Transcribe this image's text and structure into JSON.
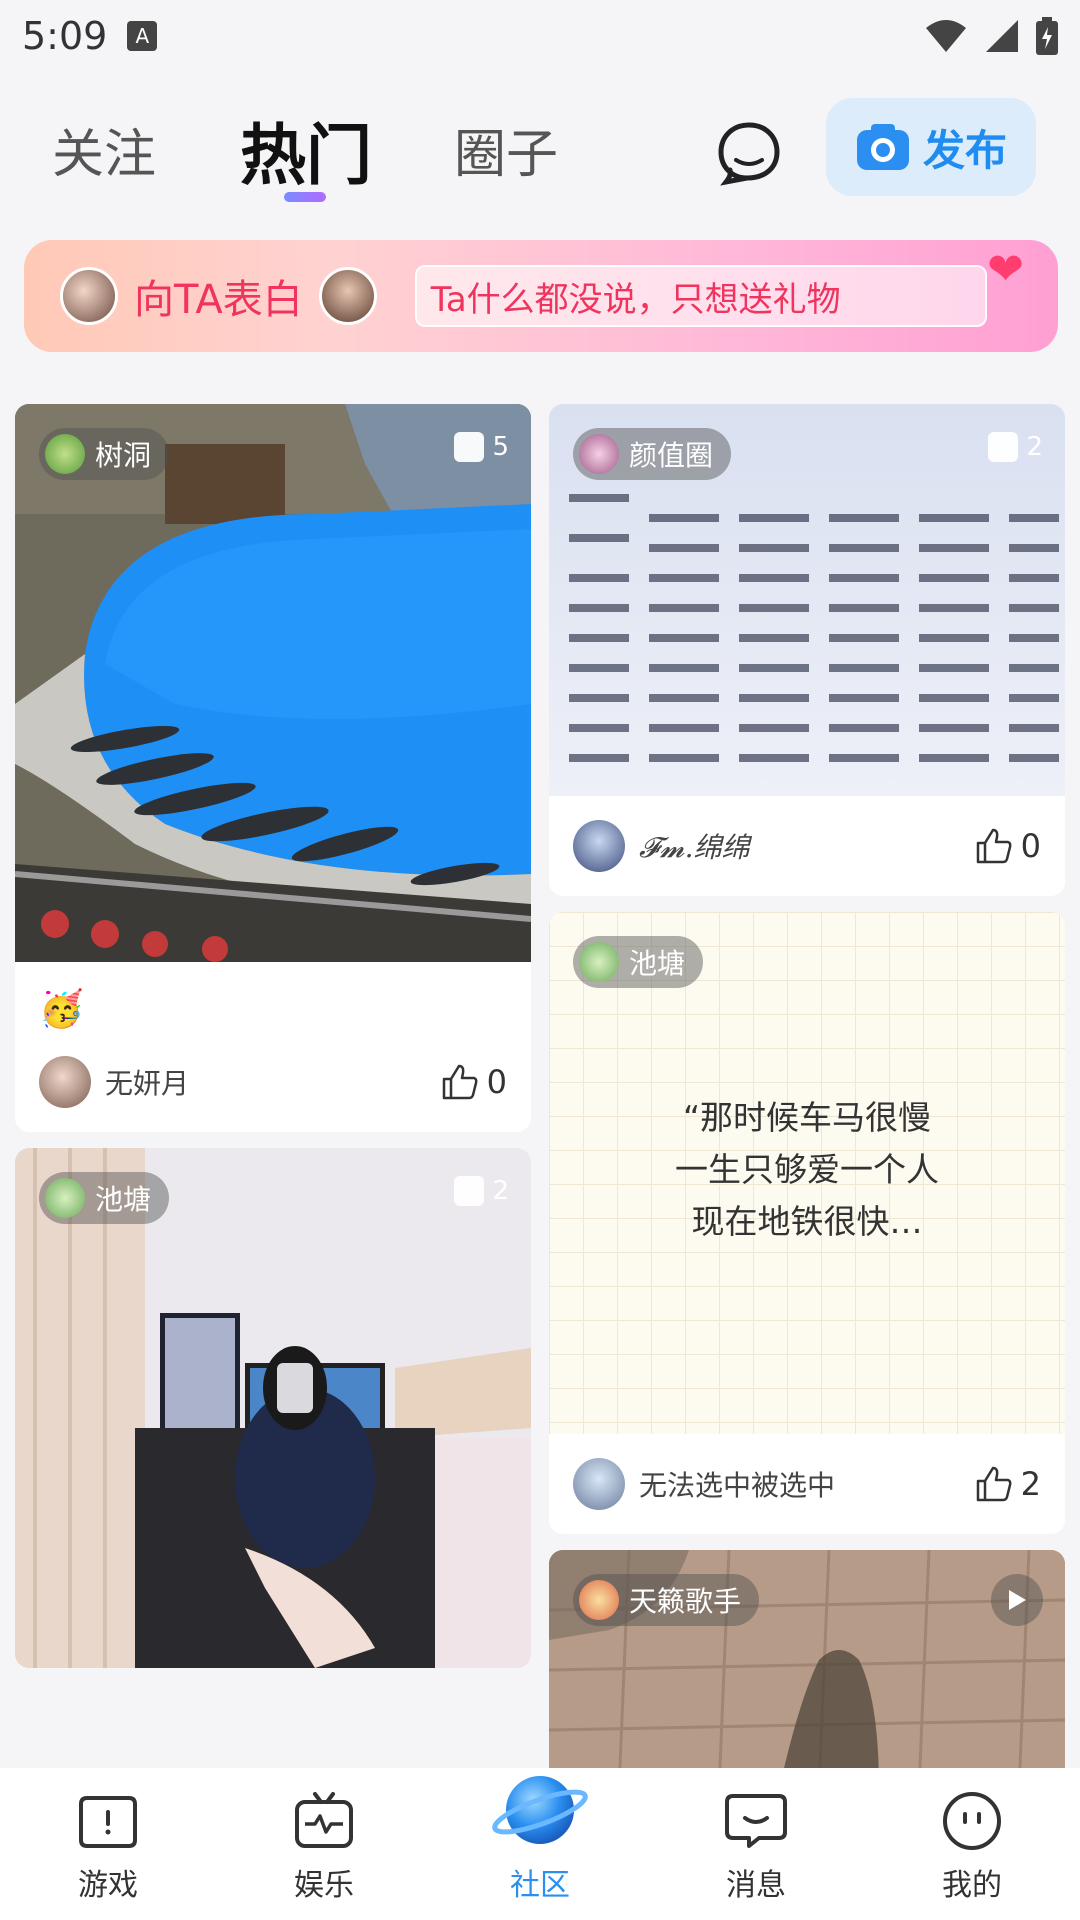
{
  "status": {
    "time": "5:09",
    "notification_glyph": "A"
  },
  "header": {
    "tabs": [
      {
        "label": "关注"
      },
      {
        "label": "热门"
      },
      {
        "label": "圈子"
      }
    ],
    "active_tab": "热门",
    "publish_label": "发布"
  },
  "banner": {
    "title": "向TA表白",
    "message": "Ta什么都没说，只想送礼物"
  },
  "feed": {
    "left": [
      {
        "tag": "树洞",
        "count": "5",
        "emoji": "🥳",
        "author": "无妍月",
        "likes": "0"
      },
      {
        "tag": "池塘",
        "count": "2"
      }
    ],
    "right": [
      {
        "tag": "颜值圈",
        "count": "2",
        "author": "𝓕𝓶.绵绵",
        "likes": "0"
      },
      {
        "tag": "池塘",
        "quote_line1": "“那时候车马很慢",
        "quote_line2": "一生只够爱一个人",
        "quote_line3": "现在地铁很快…",
        "author": "无法选中被选中",
        "likes": "2"
      },
      {
        "tag": "天籁歌手"
      }
    ]
  },
  "bottom_nav": [
    {
      "label": "游戏",
      "icon": "game-icon"
    },
    {
      "label": "娱乐",
      "icon": "tv-icon"
    },
    {
      "label": "社区",
      "icon": "planet-icon"
    },
    {
      "label": "消息",
      "icon": "message-icon"
    },
    {
      "label": "我的",
      "icon": "profile-icon"
    }
  ],
  "colors": {
    "accent": "#2a8ff0",
    "banner_text": "#f0345e"
  }
}
